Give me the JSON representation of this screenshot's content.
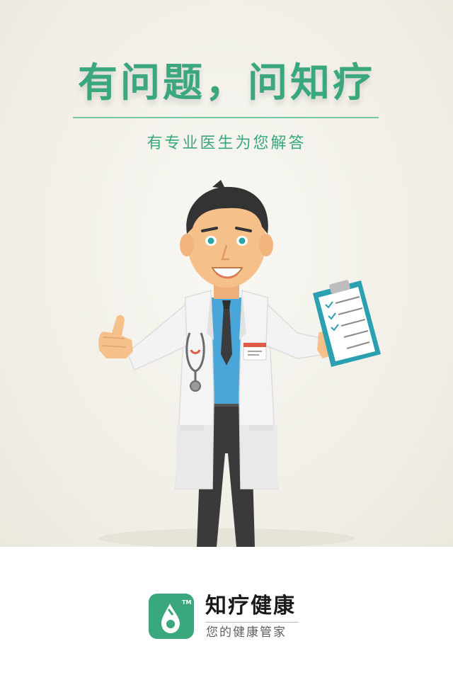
{
  "splash": {
    "headline": "有问题，问知疗",
    "subtitle": "有专业医生为您解答"
  },
  "illustration": {
    "badge_icon": "id-badge-icon",
    "clipboard_icon": "clipboard-icon",
    "stethoscope_icon": "stethoscope-icon"
  },
  "brand": {
    "name": "知疗健康",
    "slogan": "您的健康管家",
    "trademark": "TM",
    "color": "#3aa77d"
  }
}
